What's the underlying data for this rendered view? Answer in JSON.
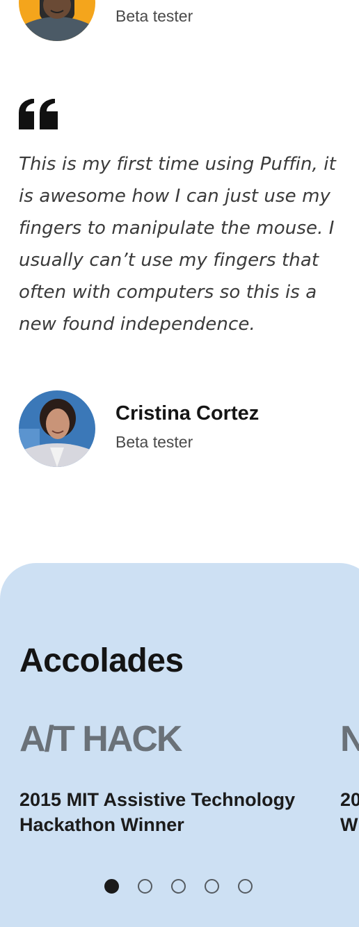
{
  "top_testimonial": {
    "role": "Beta tester"
  },
  "testimonial": {
    "quote": "This is my first time using Puffin, it is awesome how I can just use my fingers to manipulate the mouse. I usually can’t use my fingers that often with computers so this is a new found independence.",
    "author_name": "Cristina Cortez",
    "author_role": "Beta tester"
  },
  "accolades": {
    "title": "Accolades",
    "items": [
      {
        "logo_text": "A/T HACK",
        "caption_line1": "2015 MIT Assistive Technology",
        "caption_line2": "Hackathon Winner"
      },
      {
        "logo_text": "N",
        "caption_line1": "20",
        "caption_line2": "W"
      }
    ],
    "pagination": {
      "total": 5,
      "active": 1
    }
  },
  "colors": {
    "panel_bg": "#cde0f3",
    "logo_gray": "#6a7178",
    "avatar_top_bg": "#f4a51c",
    "avatar_bottom_bg": "#3b78b8"
  }
}
